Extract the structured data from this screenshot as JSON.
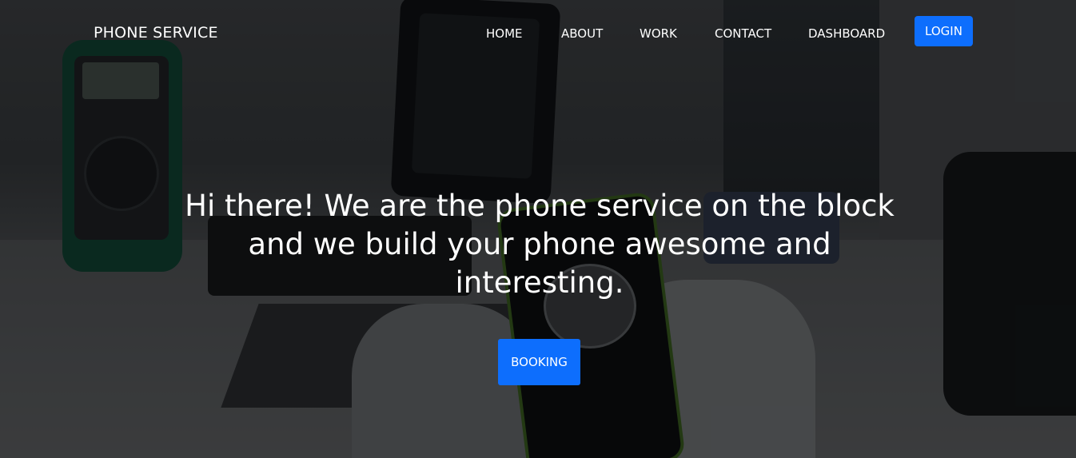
{
  "nav": {
    "brand": "PHONE SERVICE",
    "links": [
      "HOME",
      "ABOUT",
      "WORK",
      "CONTACT",
      "DASHBOARD"
    ],
    "login_label": "LOGIN"
  },
  "hero": {
    "title": "Hi there! We are the phone service on the block and we build your phone awesome and interesting.",
    "booking_label": "BOOKING"
  },
  "colors": {
    "accent": "#0d6efd",
    "text": "#ffffff",
    "overlay": "rgba(0,0,0,0.55)"
  }
}
